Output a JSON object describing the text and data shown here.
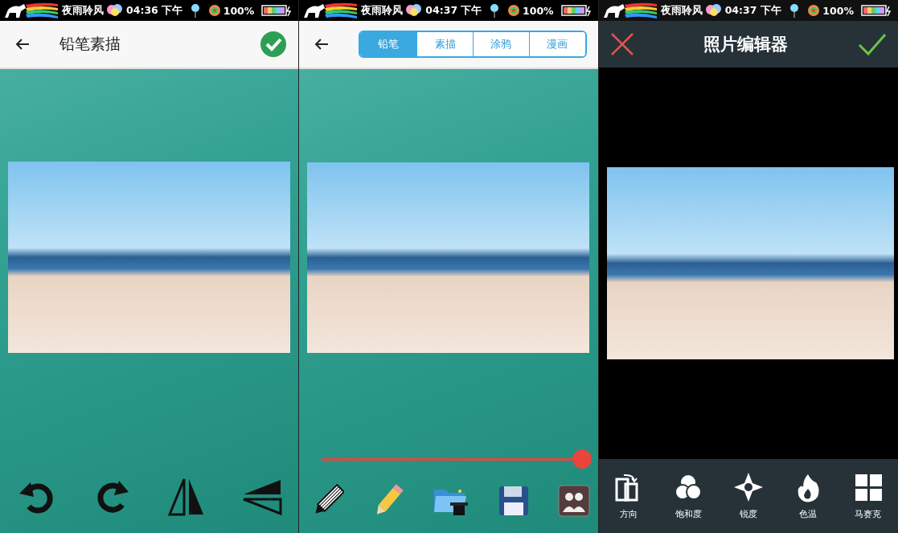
{
  "panels": [
    {
      "kind": "sketch",
      "status_bar": {
        "carrier": "夜雨聆风",
        "time": "04:36 下午",
        "battery": "100%"
      },
      "header": {
        "title": "铅笔素描"
      }
    },
    {
      "kind": "styles",
      "status_bar": {
        "carrier": "夜雨聆风",
        "time": "04:37 下午",
        "battery": "100%"
      },
      "tabs": [
        {
          "label": "铅笔",
          "selected": true
        },
        {
          "label": "素描",
          "selected": false
        },
        {
          "label": "涂鸦",
          "selected": false
        },
        {
          "label": "漫画",
          "selected": false
        }
      ],
      "slider": {
        "level": 1.0
      }
    },
    {
      "kind": "editor",
      "status_bar": {
        "carrier": "夜雨聆风",
        "time": "04:37 下午",
        "battery": "100%"
      },
      "header": {
        "title": "照片编辑器"
      },
      "tools": [
        {
          "kind": "orientation",
          "label": "方向"
        },
        {
          "kind": "saturation",
          "label": "饱和度"
        },
        {
          "kind": "sharpness",
          "label": "锐度"
        },
        {
          "kind": "temperature",
          "label": "色温"
        },
        {
          "kind": "mosaic",
          "label": "马赛克"
        }
      ]
    }
  ]
}
